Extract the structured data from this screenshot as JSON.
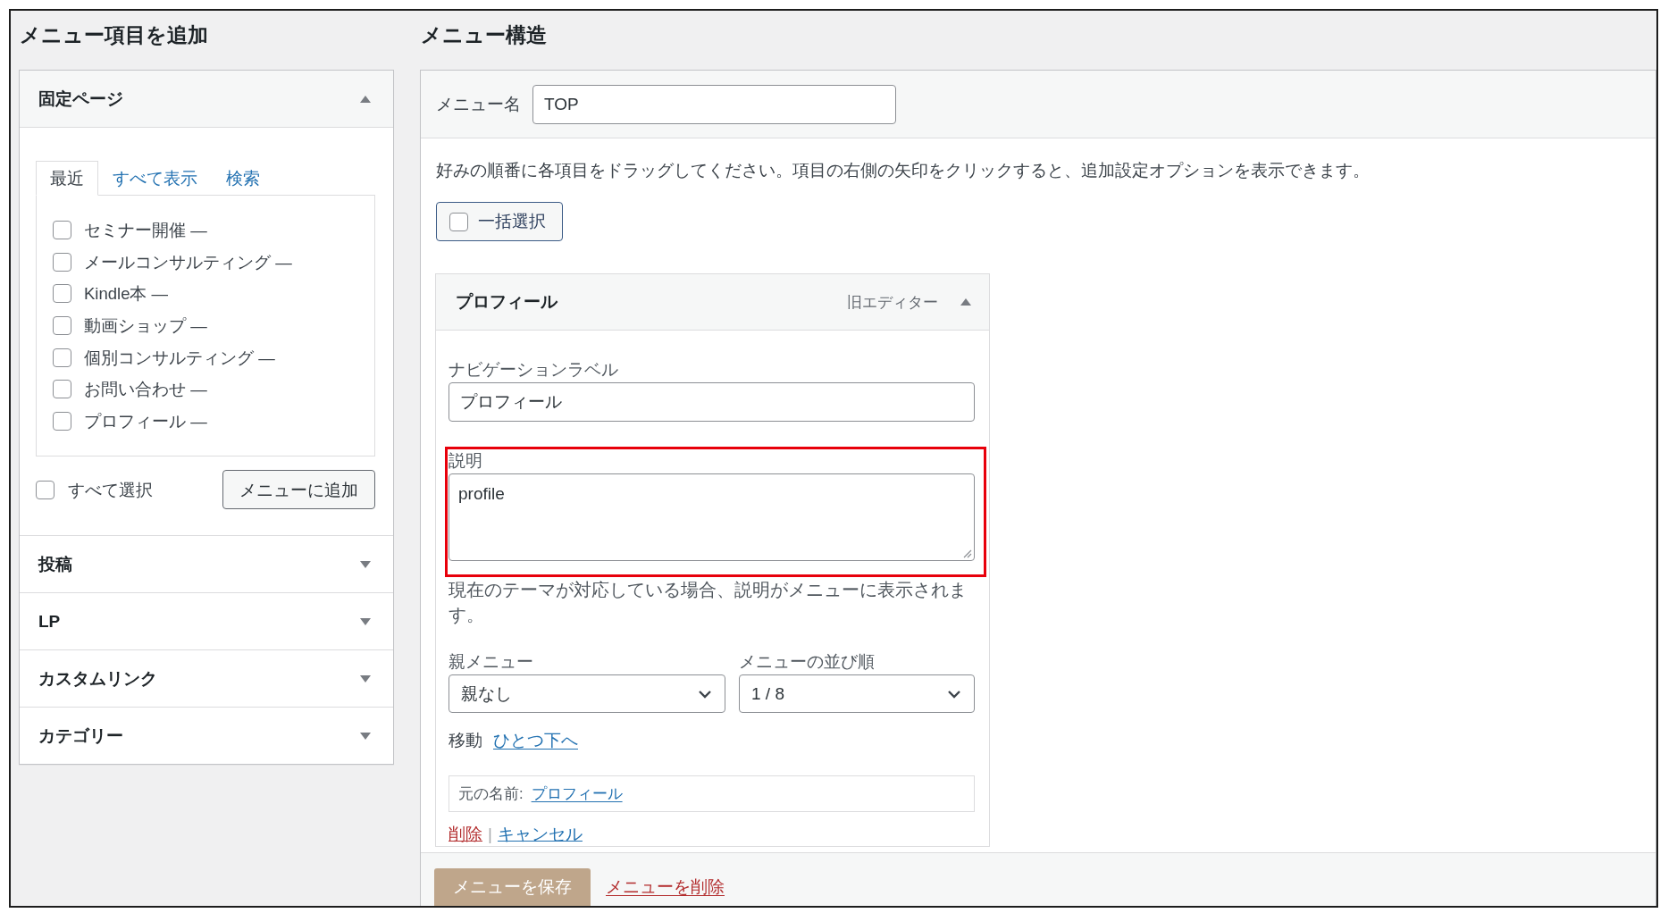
{
  "left": {
    "title": "メニュー項目を追加",
    "panels": [
      {
        "title": "固定ページ",
        "expanded": true,
        "tabs": [
          {
            "label": "最近",
            "selected": true
          },
          {
            "label": "すべて表示",
            "selected": false
          },
          {
            "label": "検索",
            "selected": false
          }
        ],
        "items": [
          {
            "label": "セミナー開催 —",
            "checked": false
          },
          {
            "label": "メールコンサルティング —",
            "checked": false
          },
          {
            "label": "Kindle本 —",
            "checked": false
          },
          {
            "label": "動画ショップ —",
            "checked": false
          },
          {
            "label": "個別コンサルティング —",
            "checked": false
          },
          {
            "label": "お問い合わせ —",
            "checked": false
          },
          {
            "label": "プロフィール —",
            "checked": false
          }
        ],
        "select_all": {
          "label": "すべて選択",
          "checked": false
        },
        "add_button": "メニューに追加"
      },
      {
        "title": "投稿",
        "expanded": false
      },
      {
        "title": "LP",
        "expanded": false
      },
      {
        "title": "カスタムリンク",
        "expanded": false
      },
      {
        "title": "カテゴリー",
        "expanded": false
      }
    ]
  },
  "right": {
    "title": "メニュー構造",
    "menu_name": {
      "label": "メニュー名",
      "value": "TOP"
    },
    "instructions": "好みの順番に各項目をドラッグしてください。項目の右側の矢印をクリックすると、追加設定オプションを表示できます。",
    "bulk_select": {
      "label": "一括選択",
      "checked": false
    },
    "menu_item": {
      "title": "プロフィール",
      "type_label": "旧エディター",
      "expanded": true,
      "nav_label": {
        "label": "ナビゲーションラベル",
        "value": "プロフィール"
      },
      "description": {
        "label": "説明",
        "value": "profile",
        "highlighted": true
      },
      "description_help": "現在のテーマが対応している場合、説明がメニューに表示されます。",
      "parent": {
        "label": "親メニュー",
        "value": "親なし"
      },
      "order": {
        "label": "メニューの並び順",
        "value": "1 / 8"
      },
      "move": {
        "label": "移動",
        "link": "ひとつ下へ"
      },
      "original": {
        "label": "元の名前:",
        "link": "プロフィール"
      },
      "actions": [
        {
          "label": "削除",
          "kind": "delete"
        },
        {
          "label": "|",
          "kind": "separator"
        },
        {
          "label": "キャンセル",
          "kind": "cancel"
        }
      ]
    },
    "footer": {
      "save_button": "メニューを保存",
      "delete_link": "メニューを削除"
    }
  }
}
